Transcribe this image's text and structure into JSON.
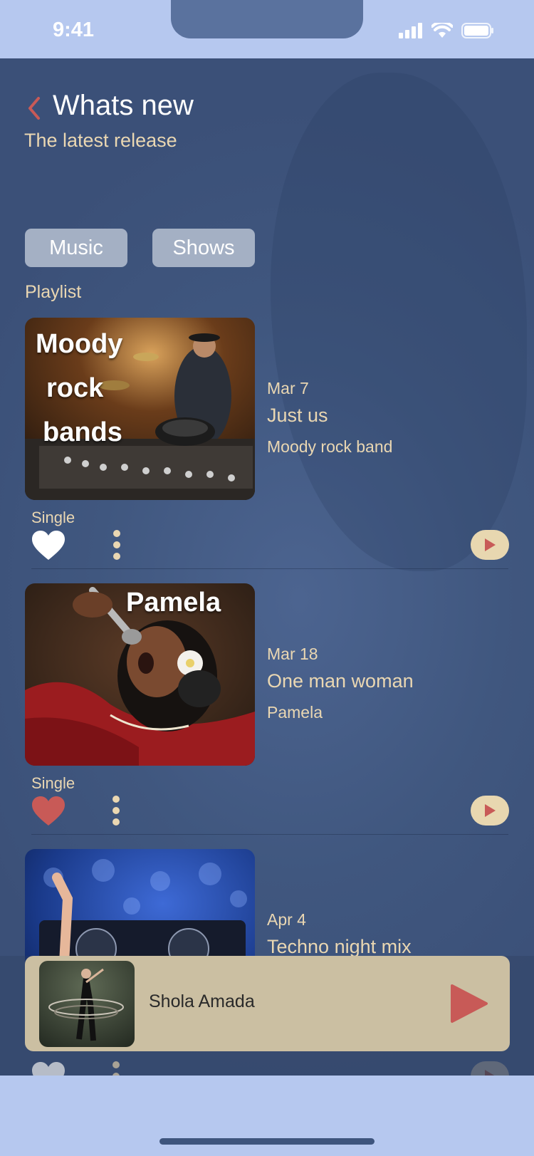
{
  "status_bar": {
    "time": "9:41"
  },
  "header": {
    "title": "Whats new",
    "subtitle": "The latest release"
  },
  "tabs": [
    {
      "label": "Music"
    },
    {
      "label": "Shows"
    }
  ],
  "section_label": "Playlist",
  "items": [
    {
      "thumb_text": [
        "Moody",
        "rock",
        "bands"
      ],
      "date": "Mar 7",
      "title": "Just us",
      "artist": "Moody rock band",
      "type": "Single",
      "liked": true
    },
    {
      "thumb_text": [
        "Pamela"
      ],
      "date": "Mar 18",
      "title": "One man woman",
      "artist": "Pamela",
      "type": "Single",
      "liked": true
    },
    {
      "thumb_text": [],
      "date": "Apr 4",
      "title": "Techno night mix",
      "artist": "",
      "type": "",
      "liked": false
    }
  ],
  "now_playing": {
    "title": "Shola Amada"
  },
  "colors": {
    "accent": "#c85a57",
    "cream": "#ead7b2",
    "background": "#40577f",
    "chip": "#a4b0c4",
    "player": "#cbbfa2"
  }
}
